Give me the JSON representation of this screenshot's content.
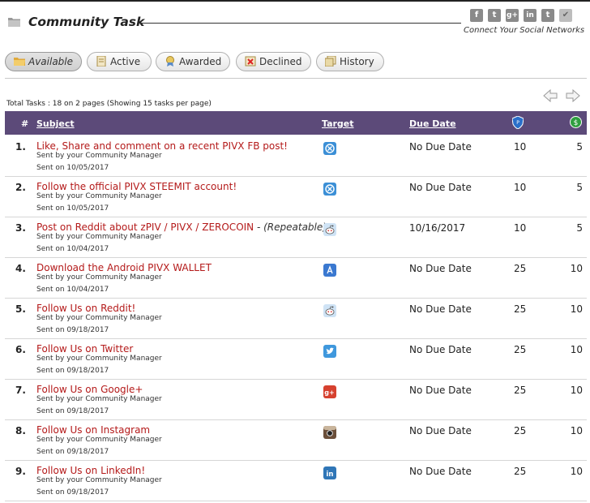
{
  "header": {
    "title": "Community Task",
    "social_caption": "Connect Your Social Networks",
    "social_icons": [
      {
        "name": "facebook-icon",
        "glyph": "f"
      },
      {
        "name": "twitter-icon",
        "glyph": "t"
      },
      {
        "name": "google-plus-icon",
        "glyph": "g+"
      },
      {
        "name": "linkedin-icon",
        "glyph": "in"
      },
      {
        "name": "tumblr-icon",
        "glyph": "t"
      },
      {
        "name": "check-icon",
        "glyph": "✔"
      }
    ]
  },
  "tabs": [
    {
      "label": "Available",
      "active": true,
      "icon": "folder-icon"
    },
    {
      "label": "Active",
      "active": false,
      "icon": "document-icon"
    },
    {
      "label": "Awarded",
      "active": false,
      "icon": "award-icon"
    },
    {
      "label": "Declined",
      "active": false,
      "icon": "declined-icon"
    },
    {
      "label": "History",
      "active": false,
      "icon": "history-icon"
    }
  ],
  "summary": "Total Tasks : 18 on 2 pages (Showing 15 tasks per page)",
  "table": {
    "headers": {
      "num": "#",
      "subject": "Subject",
      "target": "Target",
      "due": "Due Date"
    },
    "rows": [
      {
        "num": "1.",
        "subject": "Like, Share and comment on a recent PIVX FB post!",
        "repeat": "",
        "sent_by": "Sent by your Community Manager",
        "sent_on": "Sent on 10/05/2017",
        "target": "pivx",
        "due": "No Due Date",
        "points": "10",
        "reward": "5"
      },
      {
        "num": "2.",
        "subject": "Follow the official PIVX STEEMIT account!",
        "repeat": "",
        "sent_by": "Sent by your Community Manager",
        "sent_on": "Sent on 10/05/2017",
        "target": "pivx",
        "due": "No Due Date",
        "points": "10",
        "reward": "5"
      },
      {
        "num": "3.",
        "subject": "Post on Reddit about zPIV / PIVX / ZEROCOIN",
        "repeat": " - (Repeatable)",
        "sent_by": "Sent by your Community Manager",
        "sent_on": "Sent on 10/04/2017",
        "target": "reddit",
        "due": "10/16/2017",
        "points": "10",
        "reward": "5"
      },
      {
        "num": "4.",
        "subject": "Download the Android PIVX WALLET",
        "repeat": "",
        "sent_by": "Sent by your Community Manager",
        "sent_on": "Sent on 10/04/2017",
        "target": "appstore",
        "due": "No Due Date",
        "points": "25",
        "reward": "10"
      },
      {
        "num": "5.",
        "subject": "Follow Us on Reddit!",
        "repeat": "",
        "sent_by": "Sent by your Community Manager",
        "sent_on": "Sent on 09/18/2017",
        "target": "reddit",
        "due": "No Due Date",
        "points": "25",
        "reward": "10"
      },
      {
        "num": "6.",
        "subject": "Follow Us on Twitter",
        "repeat": "",
        "sent_by": "Sent by your Community Manager",
        "sent_on": "Sent on 09/18/2017",
        "target": "twitter",
        "due": "No Due Date",
        "points": "25",
        "reward": "10"
      },
      {
        "num": "7.",
        "subject": "Follow Us on Google+",
        "repeat": "",
        "sent_by": "Sent by your Community Manager",
        "sent_on": "Sent on 09/18/2017",
        "target": "googleplus",
        "due": "No Due Date",
        "points": "25",
        "reward": "10"
      },
      {
        "num": "8.",
        "subject": "Follow Us on Instagram",
        "repeat": "",
        "sent_by": "Sent by your Community Manager",
        "sent_on": "Sent on 09/18/2017",
        "target": "instagram",
        "due": "No Due Date",
        "points": "25",
        "reward": "10"
      },
      {
        "num": "9.",
        "subject": "Follow Us on LinkedIn!",
        "repeat": "",
        "sent_by": "Sent by your Community Manager",
        "sent_on": "Sent on 09/18/2017",
        "target": "linkedin",
        "due": "No Due Date",
        "points": "25",
        "reward": "10"
      }
    ]
  },
  "colors": {
    "header_bg": "#5c4a79",
    "subject_link": "#b41a1a"
  }
}
